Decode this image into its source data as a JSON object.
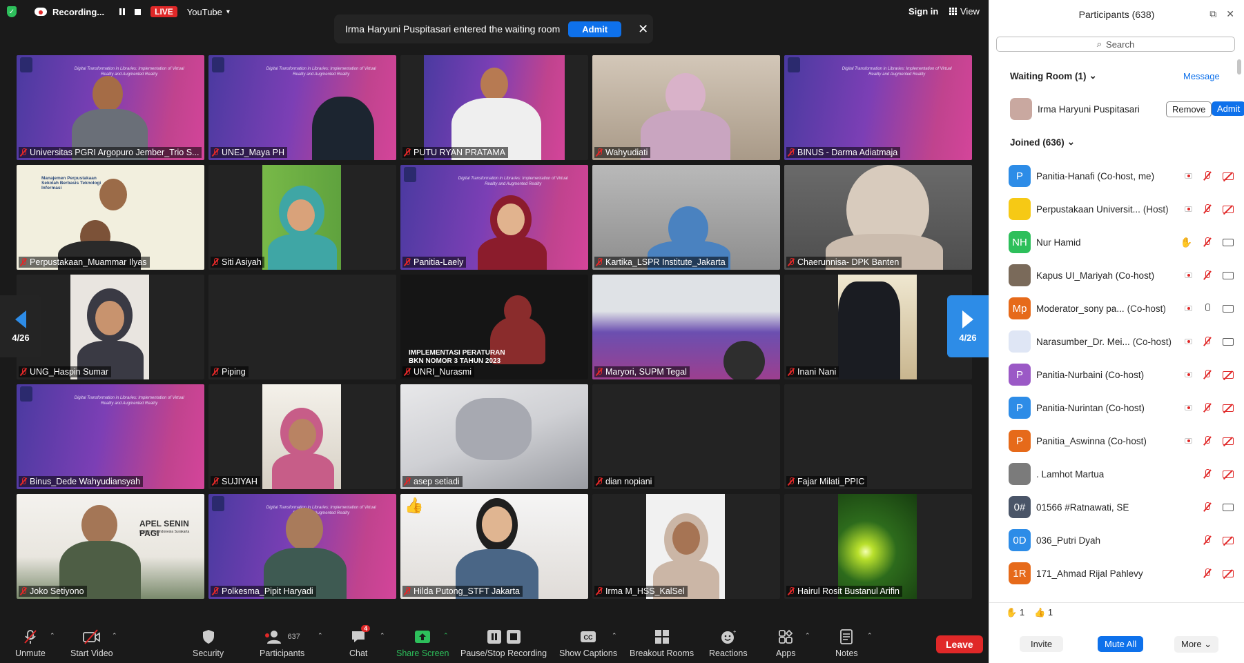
{
  "topbar": {
    "recording_label": "Recording...",
    "live_label": "LIVE",
    "stream_target": "YouTube",
    "sign_in": "Sign in",
    "view": "View"
  },
  "notification": {
    "text": "Irma Haryuni Puspitasari entered the waiting room",
    "admit": "Admit"
  },
  "slide_text": "Digital Transformation in Libraries: Implementation of Virtual Reality and Augmented Reality",
  "pager": {
    "left": "4/26",
    "right": "4/26"
  },
  "tiles": [
    "Universitas PGRI Argopuro Jember_Trio S...",
    "UNEJ_Maya PH",
    "PUTU RYAN PRATAMA",
    "Wahyudiati",
    "BINUS - Darma Adiatmaja",
    "Perpustakaan_Muammar Ilyas",
    "Siti Asiyah",
    "Panitia-Laely",
    "Kartika_LSPR Institute_Jakarta",
    "Chaerunnisa- DPK Banten",
    "UNG_Haspin Sumar",
    "Piping",
    "UNRI_Nurasmi",
    "Maryori, SUPM Tegal",
    "Inani Nani",
    "Binus_Dede Wahyudiansyah",
    "SUJIYAH",
    "asep setiadi",
    "dian nopiani",
    "Fajar Milati_PPIC",
    "Joko Setiyono",
    "Polkesma_Pipit Haryadi",
    "Hilda Putong_STFT Jakarta",
    "Irma M_HSS_KalSel",
    "Hairul Rosit Bustanul Arifin"
  ],
  "tile_texts": {
    "unri_slide": "IMPLEMENTASI PERATURAN BKN NOMOR 3 TAHUN 2023",
    "muammar_slide": "Manajemen Perpustakaan Sekolah Berbasis Teknologi Informasi",
    "joko_slide": "APEL SENIN PAGI",
    "joko_slide_sub": "Institut Seni Indonesia Surakarta"
  },
  "toolbar": {
    "unmute": "Unmute",
    "start_video": "Start Video",
    "security": "Security",
    "participants": "Participants",
    "participants_count": "637",
    "chat": "Chat",
    "chat_badge": "4",
    "share_screen": "Share Screen",
    "pause_stop": "Pause/Stop Recording",
    "captions": "Show Captions",
    "breakout": "Breakout Rooms",
    "reactions": "Reactions",
    "apps": "Apps",
    "notes": "Notes",
    "leave": "Leave"
  },
  "panel": {
    "title": "Participants (638)",
    "search_placeholder": "Search",
    "waiting_room": "Waiting Room (1)",
    "message": "Message",
    "waiting_person": "Irma Haryuni Puspitasari",
    "remove": "Remove",
    "admit": "Admit",
    "joined": "Joined (636)",
    "participants": [
      {
        "initials": "P",
        "color": "#2d8ce7",
        "name": "Panitia-Hanafi (Co-host, me)",
        "role": "",
        "rec": true,
        "mic": "off",
        "video": "off"
      },
      {
        "initials": "",
        "color": "#f6c915",
        "name": "Perpustakaan Universit...",
        "role": "(Host)",
        "rec": true,
        "mic": "off",
        "video": "off"
      },
      {
        "initials": "NH",
        "color": "#2dbf5b",
        "name": "Nur Hamid",
        "role": "",
        "rec": false,
        "hand": "✋",
        "mic": "off",
        "video": "on"
      },
      {
        "initials": "",
        "color": "#7a6a5a",
        "name": "Kapus UI_Mariyah (Co-host)",
        "role": "",
        "rec": true,
        "mic": "off",
        "video": "on"
      },
      {
        "initials": "Mp",
        "color": "#e66a1a",
        "name": "Moderator_sony pa...",
        "role": "(Co-host)",
        "rec": true,
        "mic": "on",
        "video": "on"
      },
      {
        "initials": "",
        "color": "#dfe6f5",
        "name": "Narasumber_Dr. Mei...",
        "role": "(Co-host)",
        "rec": true,
        "mic": "off",
        "video": "on"
      },
      {
        "initials": "P",
        "color": "#9b59c6",
        "name": "Panitia-Nurbaini (Co-host)",
        "role": "",
        "rec": true,
        "mic": "off",
        "video": "off"
      },
      {
        "initials": "P",
        "color": "#2d8ce7",
        "name": "Panitia-Nurintan (Co-host)",
        "role": "",
        "rec": true,
        "mic": "off",
        "video": "off"
      },
      {
        "initials": "P",
        "color": "#e66a1a",
        "name": "Panitia_Aswinna (Co-host)",
        "role": "",
        "rec": true,
        "mic": "off",
        "video": "off"
      },
      {
        "initials": "",
        "color": "#7b7b7b",
        "name": ". Lamhot Martua",
        "role": "",
        "rec": false,
        "mic": "off",
        "video": "off"
      },
      {
        "initials": "0#",
        "color": "#4a5568",
        "name": "01566 #Ratnawati, SE",
        "role": "",
        "rec": false,
        "mic": "off",
        "video": "on"
      },
      {
        "initials": "0D",
        "color": "#2d8ce7",
        "name": "036_Putri Dyah",
        "role": "",
        "rec": false,
        "mic": "off",
        "video": "off"
      },
      {
        "initials": "1R",
        "color": "#e66a1a",
        "name": "171_Ahmad Rijal Pahlevy",
        "role": "",
        "rec": false,
        "mic": "off",
        "video": "off"
      }
    ],
    "reactions": [
      {
        "emoji": "✋",
        "count": "1"
      },
      {
        "emoji": "👍",
        "count": "1"
      }
    ],
    "invite": "Invite",
    "mute_all": "Mute All",
    "more": "More"
  }
}
